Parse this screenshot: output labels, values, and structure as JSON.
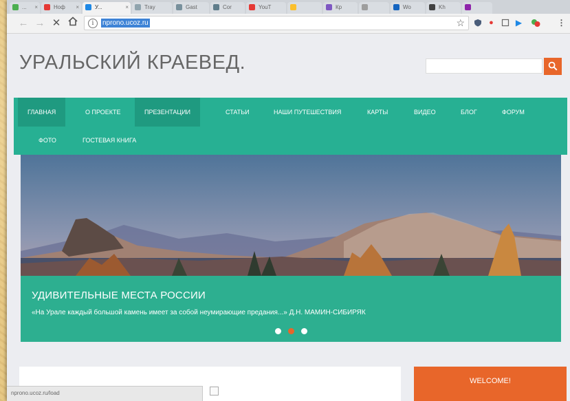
{
  "browser": {
    "tabs": [
      {
        "label": "...",
        "fav_color": "#4caf50"
      },
      {
        "label": "Ноф",
        "fav_color": "#e53935"
      },
      {
        "label": "У...",
        "fav_color": "#1e88e5",
        "active": true
      },
      {
        "label": "Tray",
        "fav_color": "#90a4ae"
      },
      {
        "label": "Gast",
        "fav_color": "#78909c"
      },
      {
        "label": "Cor",
        "fav_color": "#607d8b"
      },
      {
        "label": "YouT",
        "fav_color": "#e53935"
      },
      {
        "label": "",
        "fav_color": "#fbc02d"
      },
      {
        "label": "Кр",
        "fav_color": "#7e57c2"
      },
      {
        "label": "",
        "fav_color": "#9e9e9e"
      },
      {
        "label": "Wo",
        "fav_color": "#1565c0"
      },
      {
        "label": "Kh",
        "fav_color": "#424242"
      },
      {
        "label": "",
        "fav_color": "#8e24aa"
      }
    ],
    "url": "nprono.ucoz.ru",
    "status_url": "nprono.ucoz.ru/load"
  },
  "site": {
    "title": "УРАЛЬСКИЙ КРАЕВЕД.",
    "search": {
      "value": "",
      "icon": "search-icon"
    },
    "nav_row1": [
      "ГЛАВНАЯ",
      "О ПРОЕКТЕ",
      "ПРЕЗЕНТАЦИИ",
      "СТАТЬИ",
      "НАШИ ПУТЕШЕСТВИЯ",
      "КАРТЫ",
      "ВИДЕО",
      "БЛОГ",
      "ФОРУМ"
    ],
    "nav_row2": [
      "ФОТО",
      "ГОСТЕВАЯ КНИГА"
    ],
    "slider": {
      "title": "УДИВИТЕЛЬНЫЕ МЕСТА РОССИИ",
      "quote": "«На Урале каждый большой камень имеет за собой неумирающие предания...» Д.Н. МАМИН-СИБИРЯК",
      "slide_count": 3,
      "active_slide": 2
    },
    "welcome": "WELCOME!"
  },
  "colors": {
    "accent_orange": "#e8662a",
    "nav_green": "#27b093",
    "nav_highlight": "#1f9a80"
  }
}
